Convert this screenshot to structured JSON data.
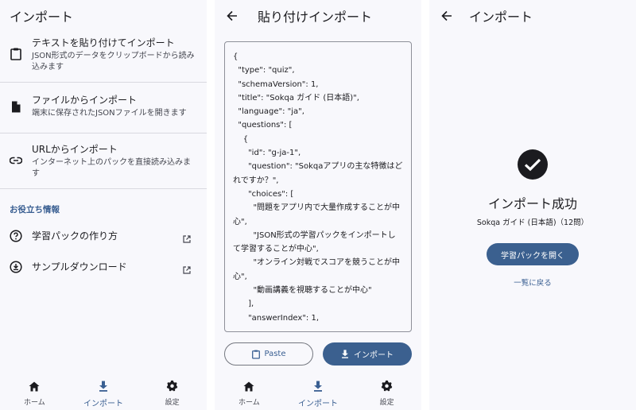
{
  "panel1": {
    "title": "インポート",
    "items": [
      {
        "label": "テキストを貼り付けてインポート",
        "desc": "JSON形式のデータをクリップボードから読み込みます",
        "icon": "clipboard-icon"
      },
      {
        "label": "ファイルからインポート",
        "desc": "端末に保存されたJSONファイルを開きます",
        "icon": "file-icon"
      },
      {
        "label": "URLからインポート",
        "desc": "インターネット上のパックを直接読み込みます",
        "icon": "link-icon"
      }
    ],
    "section_label": "お役立ち情報",
    "links": [
      {
        "label": "学習パックの作り方",
        "icon": "help-circle-icon"
      },
      {
        "label": "サンプルダウンロード",
        "icon": "download-circle-icon"
      }
    ]
  },
  "panel2": {
    "title": "貼り付けインポート",
    "json_text": "{\n  \"type\": \"quiz\",\n  \"schemaVersion\": 1,\n  \"title\": \"Sokqa ガイド (日本語)\",\n  \"language\": \"ja\",\n  \"questions\": [\n    {\n      \"id\": \"g-ja-1\",\n      \"question\": \"Sokqaアプリの主な特徴はどれですか？\",\n      \"choices\": [\n        \"問題をアプリ内で大量作成することが中心\",\n        \"JSON形式の学習パックをインポートして学習することが中心\",\n        \"オンライン対戦でスコアを競うことが中心\",\n        \"動画講義を視聴することが中心\"\n      ],\n      \"answerIndex\": 1,",
    "paste_label": "Paste",
    "import_label": "インポート"
  },
  "panel3": {
    "title": "インポート",
    "success_title": "インポート成功",
    "success_sub": "Sokqa ガイド (日本語)（12問）",
    "open_label": "学習パックを開く",
    "back_label": "一覧に戻る"
  },
  "nav": {
    "home": "ホーム",
    "import": "インポート",
    "settings": "設定"
  },
  "colors": {
    "accent": "#3b608f",
    "background": "#f8f8fc",
    "text": "#1b1b1f"
  }
}
